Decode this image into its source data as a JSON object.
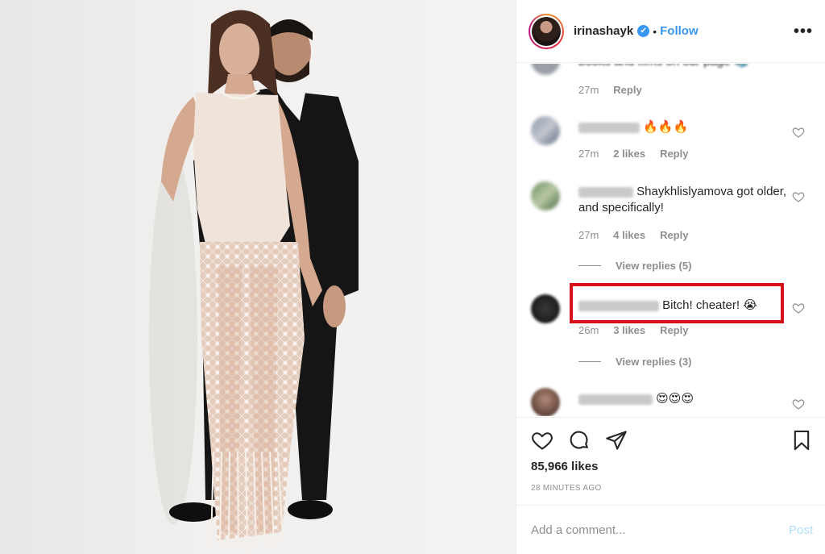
{
  "post": {
    "username": "irinashayk",
    "verified_mark": "✔",
    "separator": "•",
    "follow_label": "Follow",
    "more_label": "•••"
  },
  "comments": [
    {
      "text_tail": "books and films on our page 📚",
      "time": "27m",
      "likes": "",
      "reply_label": "Reply"
    },
    {
      "text_tail": "🔥🔥🔥",
      "time": "27m",
      "likes": "2 likes",
      "reply_label": "Reply"
    },
    {
      "text_tail": "Shaykhlislyamova got older, and specifically!",
      "time": "27m",
      "likes": "4 likes",
      "reply_label": "Reply",
      "view_replies": "View replies (5)"
    },
    {
      "text_tail": "Bitch! cheater! 😭",
      "time": "26m",
      "likes": "3 likes",
      "reply_label": "Reply",
      "view_replies": "View replies (3)"
    },
    {
      "text_tail": "😍😍😍",
      "time": "",
      "likes": "",
      "reply_label": ""
    }
  ],
  "actions": {
    "icons": [
      "heart-icon",
      "comment-icon",
      "share-icon",
      "bookmark-icon"
    ],
    "likes_count": "85,966 likes",
    "time_ago": "28 MINUTES AGO"
  },
  "add_comment": {
    "placeholder": "Add a comment...",
    "post_label": "Post"
  },
  "colors": {
    "link_blue": "#3897f0",
    "highlight_red": "#d9101b",
    "muted_text": "#8e8e8e"
  }
}
